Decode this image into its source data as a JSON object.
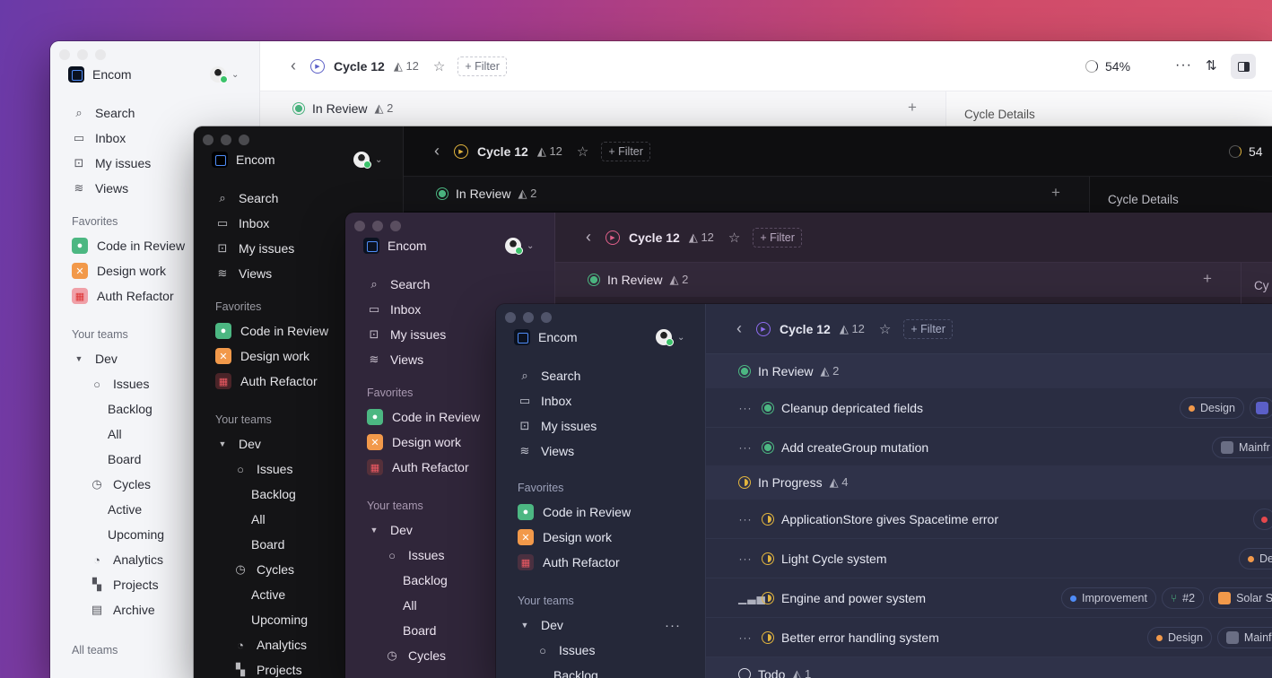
{
  "workspace": {
    "name": "Encom"
  },
  "nav": {
    "search": "Search",
    "inbox": "Inbox",
    "my_issues": "My issues",
    "views": "Views"
  },
  "favorites": {
    "label": "Favorites",
    "items": [
      "Code in Review",
      "Design work",
      "Auth Refactor"
    ]
  },
  "teams": {
    "label": "Your teams",
    "team": "Dev",
    "issues": "Issues",
    "backlog": "Backlog",
    "all": "All",
    "board": "Board",
    "cycles": "Cycles",
    "active": "Active",
    "upcoming": "Upcoming",
    "analytics": "Analytics",
    "projects": "Projects",
    "archive": "Archive",
    "all_teams": "All teams"
  },
  "topbar": {
    "cycle": "Cycle 12",
    "count": "12",
    "filter": "+ Filter",
    "progress": "54%",
    "progress_short": "54"
  },
  "groups": {
    "in_review": "In Review",
    "in_review_count": "2",
    "in_progress": "In Progress",
    "in_progress_count": "4",
    "todo": "Todo",
    "todo_count": "1"
  },
  "cycle_details": "Cycle Details",
  "cycle_details_short": "Cy",
  "issues": [
    {
      "title": "Cleanup depricated fields",
      "labels": [
        "Design"
      ]
    },
    {
      "title": "Add createGroup mutation",
      "labels": [
        "Mainfr"
      ]
    },
    {
      "title": "ApplicationStore gives Spacetime error",
      "labels": []
    },
    {
      "title": "Light Cycle system",
      "labels": [
        "De"
      ]
    },
    {
      "title": "Engine and power system",
      "labels": [
        "Improvement",
        "#2",
        "Solar S"
      ]
    },
    {
      "title": "Better error handling system",
      "labels": [
        "Design",
        "Mainfr"
      ]
    }
  ],
  "colors": {
    "light_bg": "#ffffff",
    "light_sidebar": "#f4f5f8",
    "black_bg": "#0e0e10",
    "plum_bg": "#2b2230",
    "navy_bg": "#2a2d42",
    "green": "#4cb782",
    "yellow": "#e2b53e",
    "orange": "#f2994a",
    "purple": "#8e6cf0"
  }
}
